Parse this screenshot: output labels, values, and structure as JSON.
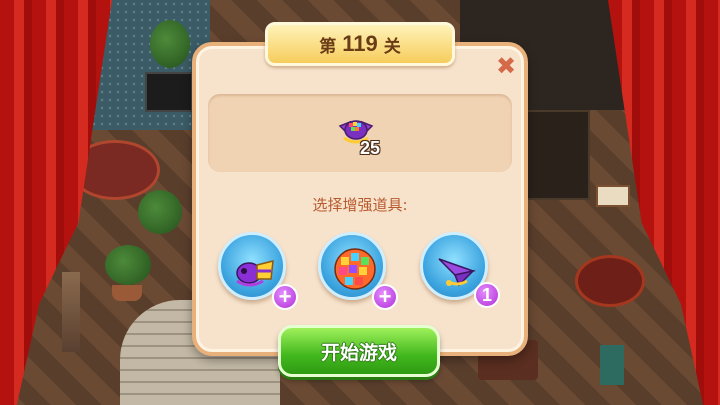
{
  "level": {
    "prefix": "第",
    "number": "119",
    "suffix": "关"
  },
  "close": {
    "icon": "close-icon",
    "glyph": "✖"
  },
  "goal": {
    "icon": "candy-wrapper-icon",
    "count": "25"
  },
  "prompt": "选择增强道具:",
  "boosters": [
    {
      "icon": "rocket-candy-icon",
      "badge": "+"
    },
    {
      "icon": "rainbow-ball-icon",
      "badge": "+"
    },
    {
      "icon": "paper-plane-icon",
      "badge": "1"
    }
  ],
  "start_button": "开始游戏",
  "colors": {
    "dialog_bg": "#f7e3cc",
    "banner": "#f6cd5c",
    "start_green": "#41b81d",
    "badge_purple": "#b02fd6",
    "curtain_red": "#d42a1f"
  }
}
